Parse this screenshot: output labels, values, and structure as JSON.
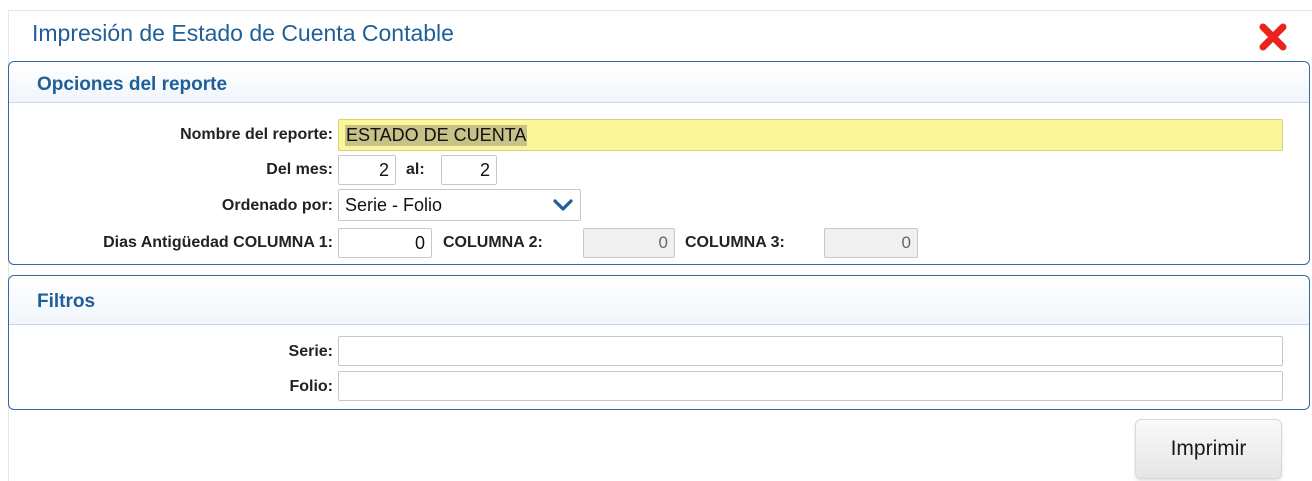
{
  "dialog": {
    "title": "Impresión de Estado de Cuenta Contable"
  },
  "options_panel": {
    "title": "Opciones del reporte",
    "report_name_label": "Nombre del reporte:",
    "report_name_value": "ESTADO DE CUENTA",
    "month_label": "Del mes:",
    "month_from": "2",
    "month_to_label": "al:",
    "month_to": "2",
    "order_label": "Ordenado por:",
    "order_value": "Serie - Folio",
    "days_col1_label": "Dias Antigüedad COLUMNA 1:",
    "days_col1_value": "0",
    "col2_label": "COLUMNA 2:",
    "col2_value": "0",
    "col3_label": "COLUMNA 3:",
    "col3_value": "0"
  },
  "filters_panel": {
    "title": "Filtros",
    "serie_label": "Serie:",
    "serie_value": "",
    "folio_label": "Folio:",
    "folio_value": ""
  },
  "actions": {
    "print_label": "Imprimir"
  },
  "colors": {
    "title_blue": "#1f5f99",
    "close_red": "#e8241c",
    "highlight_yellow": "#fbf69a"
  },
  "icons": {
    "close": "close-x-icon",
    "dropdown": "chevron-down-icon"
  }
}
